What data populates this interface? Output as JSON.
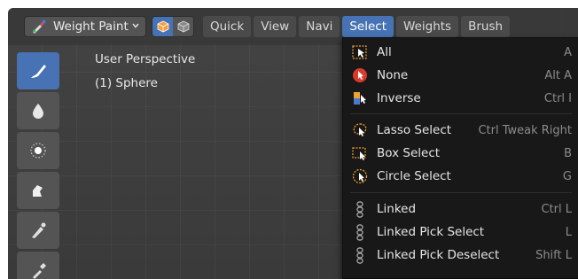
{
  "header": {
    "mode_label": "Weight Paint",
    "menus": [
      {
        "label": "Quick",
        "active": false
      },
      {
        "label": "View",
        "active": false
      },
      {
        "label": "Navi",
        "active": false
      },
      {
        "label": "Select",
        "active": true
      },
      {
        "label": "Weights",
        "active": false
      },
      {
        "label": "Brush",
        "active": false
      }
    ]
  },
  "viewport": {
    "perspective_label": "User Perspective",
    "object_label": "(1) Sphere"
  },
  "select_menu": {
    "items": [
      {
        "label": "All",
        "shortcut": "A",
        "icon": "select-all-icon"
      },
      {
        "label": "None",
        "shortcut": "Alt A",
        "icon": "select-none-icon"
      },
      {
        "label": "Inverse",
        "shortcut": "Ctrl I",
        "icon": "select-inverse-icon"
      },
      {
        "label": "Lasso Select",
        "shortcut": "Ctrl Tweak Right",
        "icon": "lasso-select-icon"
      },
      {
        "label": "Box Select",
        "shortcut": "B",
        "icon": "box-select-icon"
      },
      {
        "label": "Circle Select",
        "shortcut": "G",
        "icon": "circle-select-icon"
      },
      {
        "label": "Linked",
        "shortcut": "Ctrl L",
        "icon": "linked-icon"
      },
      {
        "label": "Linked Pick Select",
        "shortcut": "L",
        "icon": "linked-icon"
      },
      {
        "label": "Linked Pick Deselect",
        "shortcut": "Shift L",
        "icon": "linked-icon"
      }
    ]
  },
  "colors": {
    "accent": "#4772b3",
    "menu_bg": "#181818",
    "header_bg": "#393939"
  }
}
